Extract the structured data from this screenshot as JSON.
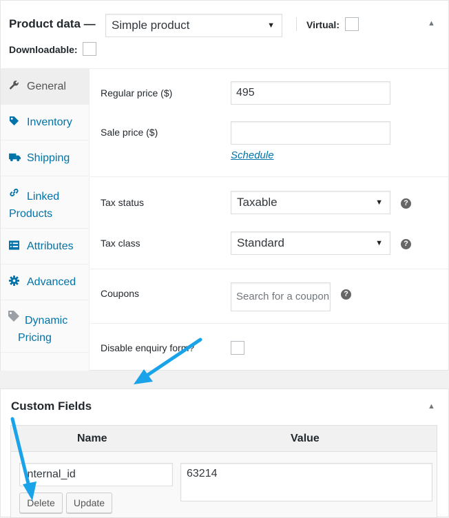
{
  "product_data": {
    "title": "Product data —",
    "type_select": "Simple product",
    "virtual_label": "Virtual:",
    "downloadable_label": "Downloadable:",
    "tabs": [
      {
        "label": "General",
        "icon": "wrench-icon"
      },
      {
        "label": "Inventory",
        "icon": "tag-icon"
      },
      {
        "label": "Shipping",
        "icon": "truck-icon"
      },
      {
        "label": "Linked Products",
        "icon": "link-icon"
      },
      {
        "label": "Attributes",
        "icon": "list-icon"
      },
      {
        "label": "Advanced",
        "icon": "gear-icon"
      },
      {
        "label": "Dynamic Pricing",
        "icon": "price-tag-icon"
      }
    ],
    "active_tab": "General",
    "general": {
      "regular_price_label": "Regular price ($)",
      "regular_price_value": "495",
      "sale_price_label": "Sale price ($)",
      "sale_price_value": "",
      "schedule_link": "Schedule",
      "tax_status_label": "Tax status",
      "tax_status_value": "Taxable",
      "tax_class_label": "Tax class",
      "tax_class_value": "Standard",
      "coupons_label": "Coupons",
      "coupons_placeholder": "Search for a coupon",
      "disable_enquiry_label": "Disable enquiry form?"
    }
  },
  "custom_fields": {
    "title": "Custom Fields",
    "columns": [
      "Name",
      "Value"
    ],
    "rows": [
      {
        "name": "internal_id",
        "value": "63214"
      }
    ],
    "delete_label": "Delete",
    "update_label": "Update"
  },
  "colors": {
    "link": "#0073aa",
    "annotation_arrow": "#1aa3e8"
  }
}
